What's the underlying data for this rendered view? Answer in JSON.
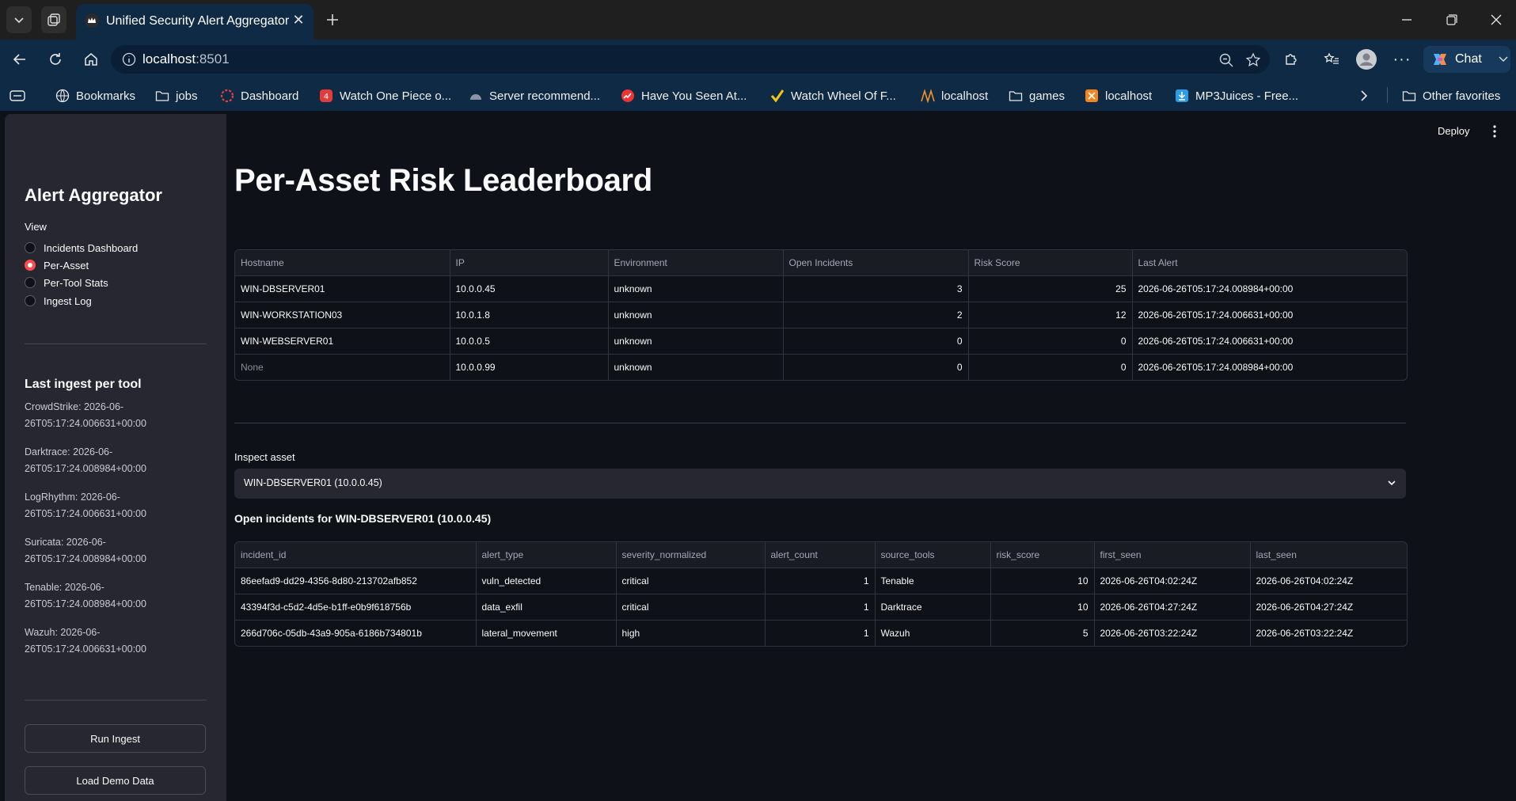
{
  "browser": {
    "tab_title": "Unified Security Alert Aggregator",
    "url_host": "localhost",
    "url_port": ":8501",
    "chat_label": "Chat",
    "bookmarks": [
      {
        "label": "Bookmarks",
        "icon": "globe-icon"
      },
      {
        "label": "jobs",
        "icon": "folder-icon"
      },
      {
        "label": "Dashboard",
        "icon": "dashboard-icon"
      },
      {
        "label": "Watch One Piece o...",
        "icon": "site-icon"
      },
      {
        "label": "Server recommend...",
        "icon": "site-icon"
      },
      {
        "label": "Have You Seen At...",
        "icon": "site-icon"
      },
      {
        "label": "Watch Wheel Of F...",
        "icon": "check-icon"
      },
      {
        "label": "localhost",
        "icon": "site-icon"
      },
      {
        "label": "games",
        "icon": "folder-icon"
      },
      {
        "label": "localhost",
        "icon": "site-icon"
      },
      {
        "label": "MP3Juices - Free...",
        "icon": "download-icon"
      }
    ],
    "other_favorites": "Other favorites"
  },
  "sidebar": {
    "title": "Alert Aggregator",
    "view_label": "View",
    "views": [
      {
        "label": "Incidents Dashboard",
        "selected": false
      },
      {
        "label": "Per-Asset",
        "selected": true
      },
      {
        "label": "Per-Tool Stats",
        "selected": false
      },
      {
        "label": "Ingest Log",
        "selected": false
      }
    ],
    "ingest_title": "Last ingest per tool",
    "ingest": [
      {
        "line1": "CrowdStrike: 2026-06-",
        "line2": "26T05:17:24.006631+00:00"
      },
      {
        "line1": "Darktrace: 2026-06-",
        "line2": "26T05:17:24.008984+00:00"
      },
      {
        "line1": "LogRhythm: 2026-06-",
        "line2": "26T05:17:24.006631+00:00"
      },
      {
        "line1": "Suricata: 2026-06-",
        "line2": "26T05:17:24.008984+00:00"
      },
      {
        "line1": "Tenable: 2026-06-",
        "line2": "26T05:17:24.008984+00:00"
      },
      {
        "line1": "Wazuh: 2026-06-",
        "line2": "26T05:17:24.006631+00:00"
      }
    ],
    "run_ingest": "Run Ingest",
    "load_demo": "Load Demo Data"
  },
  "header": {
    "deploy": "Deploy"
  },
  "main": {
    "title": "Per-Asset Risk Leaderboard",
    "leaderboard": {
      "columns": [
        "Hostname",
        "IP",
        "Environment",
        "Open Incidents",
        "Risk Score",
        "Last Alert"
      ],
      "rows": [
        [
          "WIN-DBSERVER01",
          "10.0.0.45",
          "unknown",
          "3",
          "25",
          "2026-06-26T05:17:24.008984+00:00"
        ],
        [
          "WIN-WORKSTATION03",
          "10.0.1.8",
          "unknown",
          "2",
          "12",
          "2026-06-26T05:17:24.006631+00:00"
        ],
        [
          "WIN-WEBSERVER01",
          "10.0.0.5",
          "unknown",
          "0",
          "0",
          "2026-06-26T05:17:24.006631+00:00"
        ],
        [
          "None",
          "10.0.0.99",
          "unknown",
          "0",
          "0",
          "2026-06-26T05:17:24.008984+00:00"
        ]
      ]
    },
    "inspect_label": "Inspect asset",
    "inspect_value": "WIN-DBSERVER01 (10.0.0.45)",
    "incidents_title": "Open incidents for WIN-DBSERVER01 (10.0.0.45)",
    "incidents": {
      "columns": [
        "incident_id",
        "alert_type",
        "severity_normalized",
        "alert_count",
        "source_tools",
        "risk_score",
        "first_seen",
        "last_seen"
      ],
      "rows": [
        [
          "86eefad9-dd29-4356-8d80-213702afb852",
          "vuln_detected",
          "critical",
          "1",
          "Tenable",
          "10",
          "2026-06-26T04:02:24Z",
          "2026-06-26T04:02:24Z"
        ],
        [
          "43394f3d-c5d2-4d5e-b1ff-e0b9f618756b",
          "data_exfil",
          "critical",
          "1",
          "Darktrace",
          "10",
          "2026-06-26T04:27:24Z",
          "2026-06-26T04:27:24Z"
        ],
        [
          "266d706c-05db-43a9-905a-6186b734801b",
          "lateral_movement",
          "high",
          "1",
          "Wazuh",
          "5",
          "2026-06-26T03:22:24Z",
          "2026-06-26T03:22:24Z"
        ]
      ]
    }
  }
}
